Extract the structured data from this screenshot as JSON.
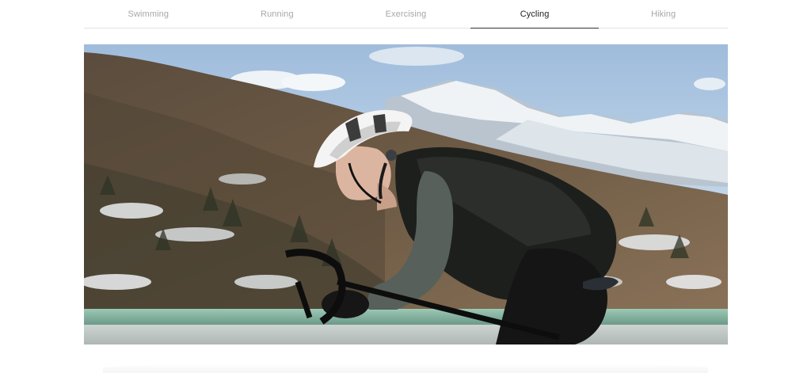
{
  "tabs": [
    {
      "label": "Swimming",
      "active": false
    },
    {
      "label": "Running",
      "active": false
    },
    {
      "label": "Exercising",
      "active": false
    },
    {
      "label": "Cycling",
      "active": true
    },
    {
      "label": "Hiking",
      "active": false
    }
  ],
  "hero_image": {
    "subject": "cyclist-in-helmet-with-open-ear-headphones"
  },
  "colors": {
    "active_tab_text": "#222222",
    "inactive_tab_text": "#a7a7a7",
    "active_underline": "#333333",
    "divider": "#e3e3e3"
  }
}
